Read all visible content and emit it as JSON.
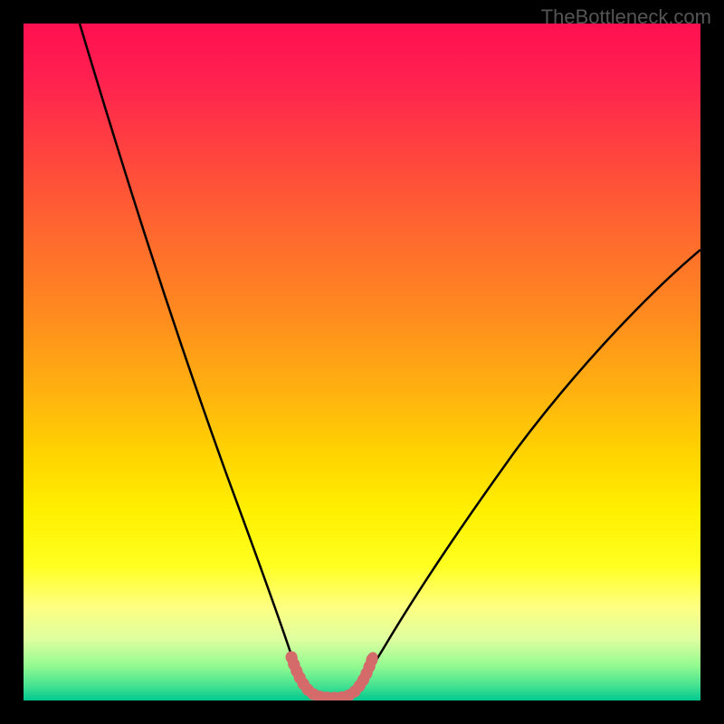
{
  "watermark": "TheBottleneck.com",
  "chart_data": {
    "type": "line",
    "title": "",
    "xlabel": "",
    "ylabel": "",
    "xlim": [
      0,
      100
    ],
    "ylim": [
      0,
      100
    ],
    "series": [
      {
        "name": "left-curve",
        "x": [
          8,
          12,
          16,
          20,
          24,
          28,
          32,
          35,
          37,
          39,
          40,
          41,
          42,
          43
        ],
        "y": [
          100,
          82,
          67,
          54,
          43,
          33,
          23,
          14,
          9,
          5,
          3,
          2,
          1.2,
          0.8
        ]
      },
      {
        "name": "right-curve",
        "x": [
          48,
          49,
          50,
          52,
          55,
          60,
          66,
          74,
          84,
          94,
          100
        ],
        "y": [
          0.8,
          1.2,
          2,
          4,
          8,
          14,
          22,
          32,
          45,
          58,
          67
        ]
      },
      {
        "name": "bottom-segment",
        "x": [
          39,
          40,
          41,
          42,
          43,
          44,
          45,
          46,
          47,
          48,
          49,
          50,
          51
        ],
        "y": [
          5,
          3,
          2,
          1.2,
          0.8,
          0.6,
          0.5,
          0.5,
          0.6,
          0.8,
          1.2,
          2,
          4
        ],
        "color": "#d46a6a",
        "width": 12
      }
    ],
    "gradient_stops": [
      {
        "pos": 0,
        "color": "#ff1050"
      },
      {
        "pos": 50,
        "color": "#ffd000"
      },
      {
        "pos": 80,
        "color": "#ffff40"
      },
      {
        "pos": 100,
        "color": "#00c890"
      }
    ]
  }
}
